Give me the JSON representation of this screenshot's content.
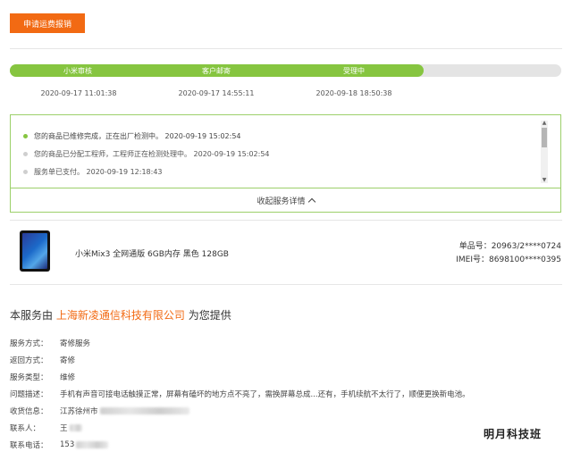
{
  "header": {
    "apply_button_label": "申请运费报销"
  },
  "progress": {
    "fill_fraction": 0.75,
    "steps": [
      {
        "label": "小米审核",
        "time": "2020-09-17 11:01:38"
      },
      {
        "label": "客户邮寄",
        "time": "2020-09-17 14:55:11"
      },
      {
        "label": "受理中",
        "time": "2020-09-18 18:50:38"
      }
    ]
  },
  "log": {
    "items": [
      {
        "text": "您的商品已维修完成，正在出厂检测中。 2020-09-19 15:02:54",
        "active": true
      },
      {
        "text": "您的商品已分配工程师，工程师正在检测处理中。 2020-09-19 15:02:54",
        "active": false
      },
      {
        "text": "服务单已支付。 2020-09-19 12:18:43",
        "active": false
      }
    ],
    "collapse_label": "收起服务详情"
  },
  "product": {
    "name": "小米Mix3 全网通版 6GB内存 黑色 128GB",
    "serial_label": "单品号：20963/2****0724",
    "imei_label": "IMEI号：8698100****0395"
  },
  "provider": {
    "prefix": "本服务由",
    "company": "上海新凌通信科技有限公司",
    "suffix": "为您提供"
  },
  "info": {
    "service_mode": {
      "label": "服务方式：",
      "value": "寄修服务"
    },
    "return_mode": {
      "label": "返回方式：",
      "value": "寄修"
    },
    "service_type": {
      "label": "服务类型：",
      "value": "维修"
    },
    "problem": {
      "label": "问题描述：",
      "value": "手机有声音可接电话触摸正常，屏幕有磕坏的地方点不亮了，需换屏幕总成...还有，手机续航不太行了，顺便更换新电池。"
    },
    "address": {
      "label": "收货信息：",
      "value": "江苏徐州市"
    },
    "contact": {
      "label": "联系人：",
      "value": "王"
    },
    "phone": {
      "label": "联系电话：",
      "value": "153"
    }
  },
  "watermark": "明月科技班",
  "colors": {
    "accent_orange": "#f26a13",
    "progress_green": "#86c540",
    "box_border": "#9cd06a"
  }
}
